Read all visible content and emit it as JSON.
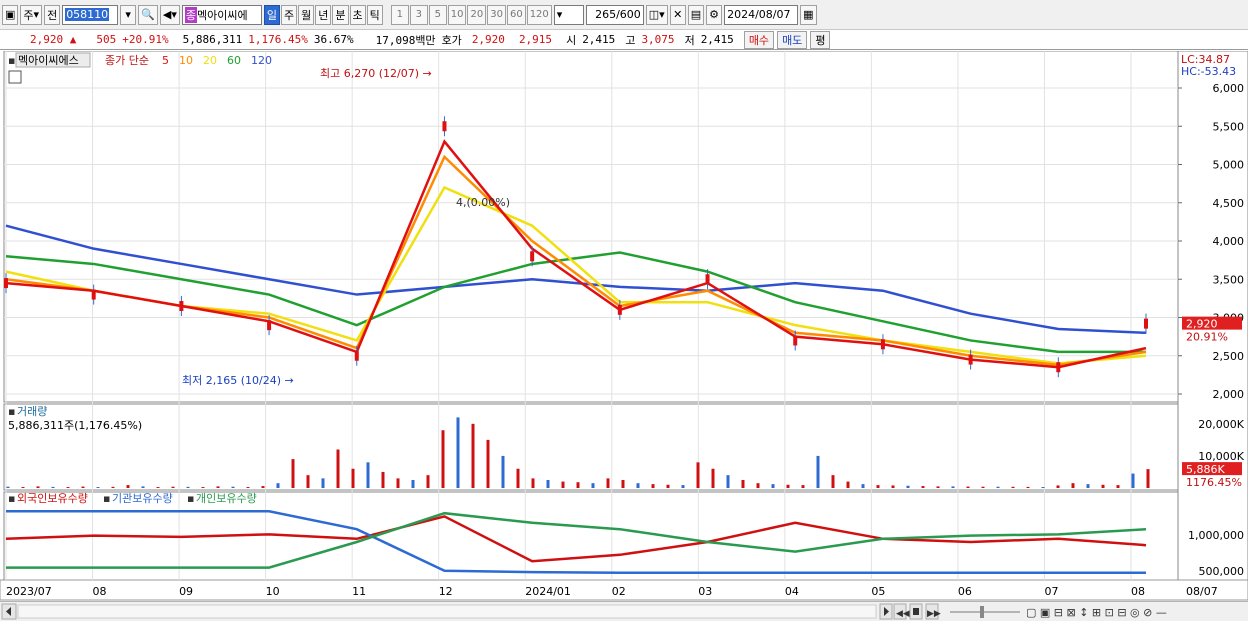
{
  "toolbar": {
    "market": "주",
    "prev": "전",
    "code": "058110",
    "name_tag": "종",
    "name": "멕아이씨에",
    "periods": [
      "일",
      "주",
      "월",
      "년",
      "분",
      "초",
      "틱"
    ],
    "active_period": "일",
    "intervals": [
      "1",
      "3",
      "5",
      "10",
      "20",
      "30",
      "60",
      "120"
    ],
    "count": "265",
    "count_max": "/600",
    "date": "2024/08/07"
  },
  "quote": {
    "price": "2,920",
    "change": "505",
    "change_pct": "+20.91%",
    "volume": "5,886,311",
    "volume_pct": "1,176.45%",
    "turnover": "36.67%",
    "amount": "17,098백만",
    "ask_label": "호가",
    "ask1": "2,920",
    "ask2": "2,915",
    "open_label": "시",
    "open": "2,415",
    "high_label": "고",
    "high": "3,075",
    "low_label": "저",
    "low": "2,415",
    "buy": "매수",
    "sell": "매도",
    "avg": "평"
  },
  "chart_data": {
    "type": "line",
    "legend": {
      "name": "멕아이씨에스",
      "kind": "종가 단순",
      "ma": [
        {
          "label": "5",
          "color": "#e01010"
        },
        {
          "label": "10",
          "color": "#ff8c00"
        },
        {
          "label": "20",
          "color": "#f0e010"
        },
        {
          "label": "60",
          "color": "#20a030"
        },
        {
          "label": "120",
          "color": "#3050d0"
        }
      ]
    },
    "lc_label": "LC:34.87",
    "hc_label": "HC:-53.43",
    "price_ticks": [
      "6,000",
      "5,500",
      "5,000",
      "4,500",
      "4,000",
      "3,500",
      "3,000",
      "2,500",
      "2,000"
    ],
    "price_tick_values": [
      6000,
      5500,
      5000,
      4500,
      4000,
      3500,
      3000,
      2500,
      2000
    ],
    "current_price_tag": "2,920",
    "current_pct_tag": "20.91%",
    "max_note": "최고 6,270 (12/07)",
    "min_note": "최저 2,165 (10/24)",
    "mid_note": "4,(0.00%)",
    "price_series": {
      "x": [
        "2023/07",
        "08",
        "09",
        "10",
        "11",
        "12",
        "2024/01",
        "02",
        "03",
        "04",
        "05",
        "06",
        "07",
        "08"
      ],
      "close": [
        3450,
        3300,
        3150,
        2900,
        2500,
        5500,
        3800,
        3100,
        3500,
        2700,
        2650,
        2450,
        2350,
        2920
      ],
      "ma5": [
        3450,
        3350,
        3150,
        2950,
        2550,
        5300,
        3900,
        3100,
        3450,
        2750,
        2650,
        2450,
        2350,
        2600
      ],
      "ma10": [
        3500,
        3350,
        3150,
        3000,
        2600,
        5100,
        4000,
        3150,
        3350,
        2800,
        2700,
        2500,
        2380,
        2550
      ],
      "ma20": [
        3600,
        3350,
        3150,
        3050,
        2700,
        4700,
        4200,
        3200,
        3200,
        2900,
        2700,
        2550,
        2400,
        2500
      ],
      "ma60": [
        3800,
        3700,
        3500,
        3300,
        2900,
        3400,
        3700,
        3850,
        3600,
        3200,
        2950,
        2700,
        2550,
        2550
      ],
      "ma120": [
        4200,
        3900,
        3700,
        3500,
        3300,
        3400,
        3500,
        3400,
        3350,
        3450,
        3350,
        3050,
        2850,
        2800
      ]
    },
    "volume_panel": {
      "title": "거래량",
      "value": "5,886,311주(1,176.45%)",
      "ticks": [
        "20,000K",
        "10,000K"
      ],
      "tick_values": [
        20000,
        10000
      ],
      "tag": "5,886K",
      "tag_pct": "1176.45%",
      "values": [
        400,
        300,
        500,
        350,
        300,
        450,
        300,
        350,
        900,
        500,
        300,
        400,
        350,
        300,
        500,
        400,
        300,
        600,
        1500,
        9000,
        4000,
        3000,
        12000,
        6000,
        8000,
        5000,
        3000,
        2500,
        4000,
        18000,
        22000,
        20000,
        15000,
        10000,
        6000,
        3000,
        2500,
        2000,
        1800,
        1500,
        3000,
        2500,
        1500,
        1200,
        1000,
        900,
        8000,
        6000,
        4000,
        2500,
        1500,
        1200,
        1000,
        900,
        10000,
        4000,
        2000,
        1200,
        900,
        800,
        700,
        600,
        500,
        500,
        450,
        400,
        400,
        380,
        350,
        300,
        800,
        1500,
        1200,
        1000,
        900,
        4500,
        5886
      ]
    },
    "holdings_panel": {
      "series": [
        "외국인보유수량",
        "기관보유수량",
        "개인보유수량"
      ],
      "colors": [
        "#d01010",
        "#2d6ad2",
        "#2a9a50"
      ],
      "ticks": [
        "1,000,000",
        "500,000"
      ],
      "tick_values": [
        1000000,
        500000
      ]
    },
    "x_labels": [
      "2023/07",
      "08",
      "09",
      "10",
      "11",
      "12",
      "2024/01",
      "02",
      "03",
      "04",
      "05",
      "06",
      "07",
      "08"
    ],
    "x_right_label": "08/07"
  }
}
